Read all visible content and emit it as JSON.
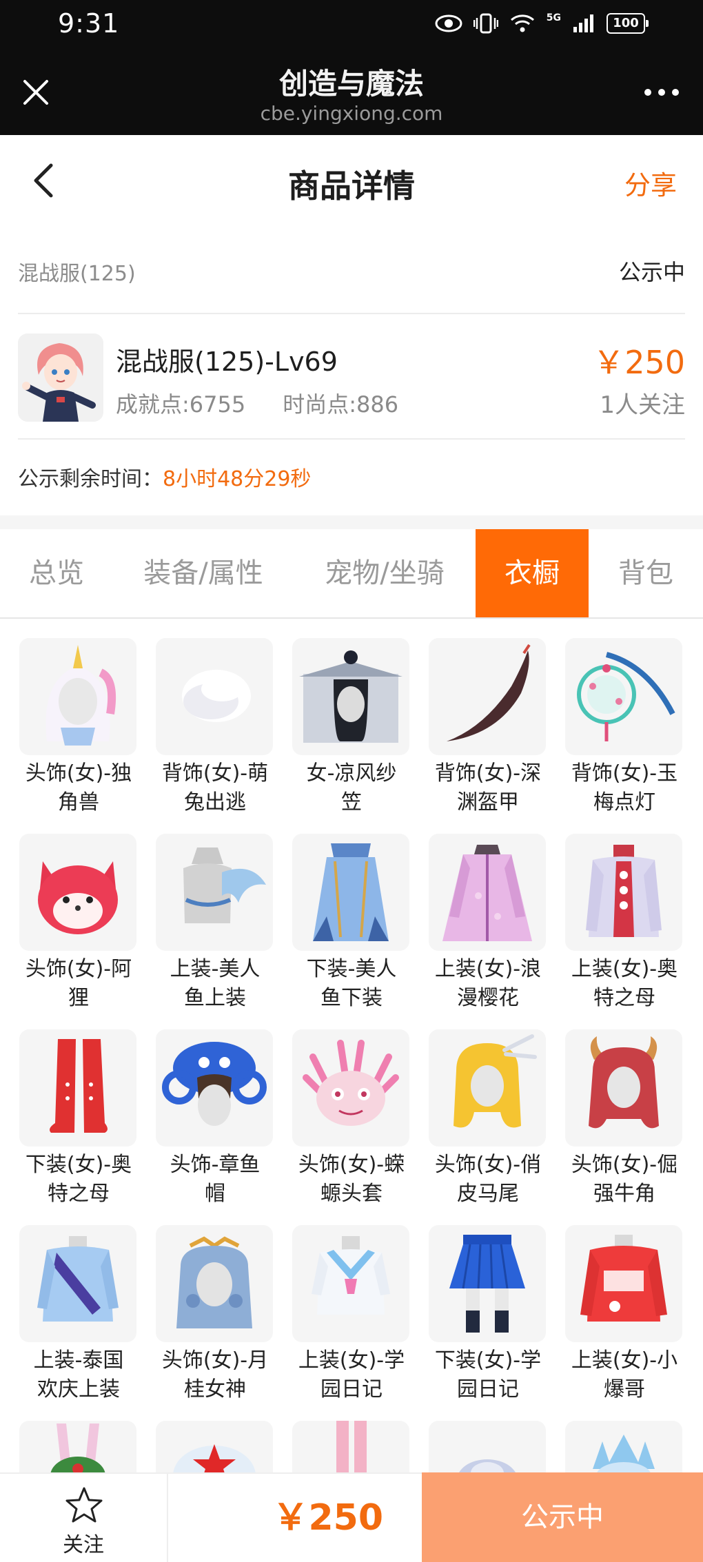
{
  "status_bar": {
    "time": "9:31",
    "network": "5G",
    "battery": "100"
  },
  "browser": {
    "title": "创造与魔法",
    "url": "cbe.yingxiong.com"
  },
  "header": {
    "title": "商品详情",
    "share_label": "分享"
  },
  "listing": {
    "server": "混战服(125)",
    "status": "公示中",
    "name": "混战服(125)-Lv69",
    "achievement": "成就点:6755",
    "fashion": "时尚点:886",
    "price": "￥250",
    "followers": "1人关注",
    "timer_label": "公示剩余时间：",
    "timer_value": "8小时48分29秒"
  },
  "tabs": [
    {
      "label": "总览",
      "active": false
    },
    {
      "label": "装备/属性",
      "active": false
    },
    {
      "label": "宠物/坐骑",
      "active": false
    },
    {
      "label": "衣橱",
      "active": true
    },
    {
      "label": "背包",
      "active": false
    }
  ],
  "wardrobe": [
    {
      "line1": "头饰(女)-独",
      "line2": "角兽",
      "icon": "unicorn-hood-icon"
    },
    {
      "line1": "背饰(女)-萌",
      "line2": "兔出逃",
      "icon": "white-fluff-icon"
    },
    {
      "line1": "女-凉风纱",
      "line2": "笠",
      "icon": "veiled-hat-icon"
    },
    {
      "line1": "背饰(女)-深",
      "line2": "渊盔甲",
      "icon": "dark-blade-icon"
    },
    {
      "line1": "背饰(女)-玉",
      "line2": "梅点灯",
      "icon": "lantern-icon"
    },
    {
      "line1": "头饰(女)-阿",
      "line2": "狸",
      "icon": "red-fox-mask-icon"
    },
    {
      "line1": "上装-美人",
      "line2": "鱼上装",
      "icon": "mermaid-top-icon"
    },
    {
      "line1": "下装-美人",
      "line2": "鱼下装",
      "icon": "mermaid-skirt-icon"
    },
    {
      "line1": "上装(女)-浪",
      "line2": "漫樱花",
      "icon": "sakura-dress-icon"
    },
    {
      "line1": "上装(女)-奥",
      "line2": "特之母",
      "icon": "ultra-top-icon"
    },
    {
      "line1": "下装(女)-奥",
      "line2": "特之母",
      "icon": "red-boots-icon"
    },
    {
      "line1": "头饰-章鱼",
      "line2": "帽",
      "icon": "octopus-hat-icon"
    },
    {
      "line1": "头饰(女)-蝾",
      "line2": "螈头套",
      "icon": "axolotl-hood-icon"
    },
    {
      "line1": "头饰(女)-俏",
      "line2": "皮马尾",
      "icon": "blonde-ponytail-icon"
    },
    {
      "line1": "头饰(女)-倔",
      "line2": "强牛角",
      "icon": "horned-hair-icon"
    },
    {
      "line1": "上装-泰国",
      "line2": "欢庆上装",
      "icon": "thai-top-icon"
    },
    {
      "line1": "头饰(女)-月",
      "line2": "桂女神",
      "icon": "moon-goddess-icon"
    },
    {
      "line1": "上装(女)-学",
      "line2": "园日记",
      "icon": "sailor-top-icon"
    },
    {
      "line1": "下装(女)-学",
      "line2": "园日记",
      "icon": "pleated-skirt-icon"
    },
    {
      "line1": "上装(女)-小",
      "line2": "爆哥",
      "icon": "red-hoodie-icon"
    },
    {
      "line1": "",
      "line2": "",
      "icon": "bunny-hat-icon"
    },
    {
      "line1": "",
      "line2": "",
      "icon": "star-cap-icon"
    },
    {
      "line1": "",
      "line2": "",
      "icon": "pink-stockings-icon"
    },
    {
      "line1": "",
      "line2": "",
      "icon": "silver-hair-icon"
    },
    {
      "line1": "",
      "line2": "",
      "icon": "ice-crown-icon"
    }
  ],
  "bottom": {
    "follow_label": "关注",
    "price": "￥250",
    "status": "公示中"
  },
  "colors": {
    "accent": "#ff6a06",
    "price": "#f26b0f",
    "status_button": "#fba071"
  }
}
